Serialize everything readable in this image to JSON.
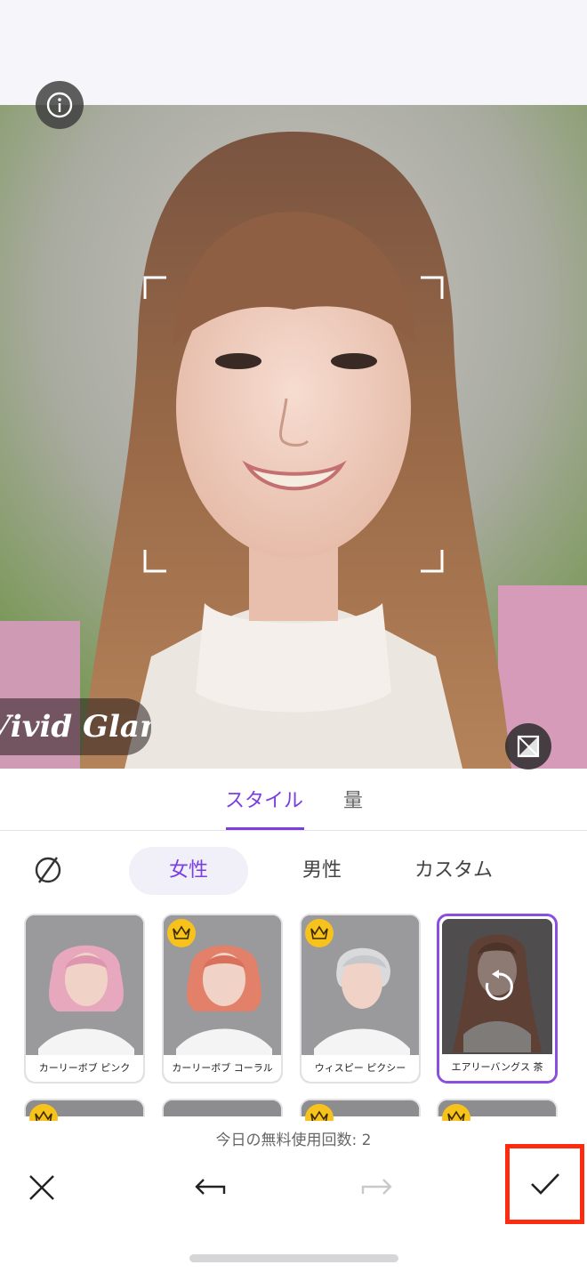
{
  "photo": {
    "watermark_text": "Vivid Glam"
  },
  "icons": {
    "info": "info-icon",
    "compare": "compare-icon",
    "none": "no-style-icon",
    "crown": "crown-icon",
    "refresh": "refresh-icon",
    "close": "close-icon",
    "undo": "undo-icon",
    "redo": "redo-icon",
    "confirm": "check-icon"
  },
  "tabs": {
    "style": "スタイル",
    "amount": "量"
  },
  "filters": {
    "female": "女性",
    "male": "男性",
    "custom": "カスタム"
  },
  "styles": [
    {
      "label": "カーリーボブ ピンク",
      "premium": false,
      "selected": false
    },
    {
      "label": "カーリーボブ コーラル",
      "premium": true,
      "selected": false
    },
    {
      "label": "ウィスピー ピクシー",
      "premium": true,
      "selected": false
    },
    {
      "label": "エアリーバングス 茶",
      "premium": false,
      "selected": true
    }
  ],
  "bottom": {
    "free_uses": "今日の無料使用回数: 2"
  },
  "colors": {
    "accent": "#7b3fe0",
    "crown": "#f6c21b",
    "highlight": "#ff2a0f"
  }
}
